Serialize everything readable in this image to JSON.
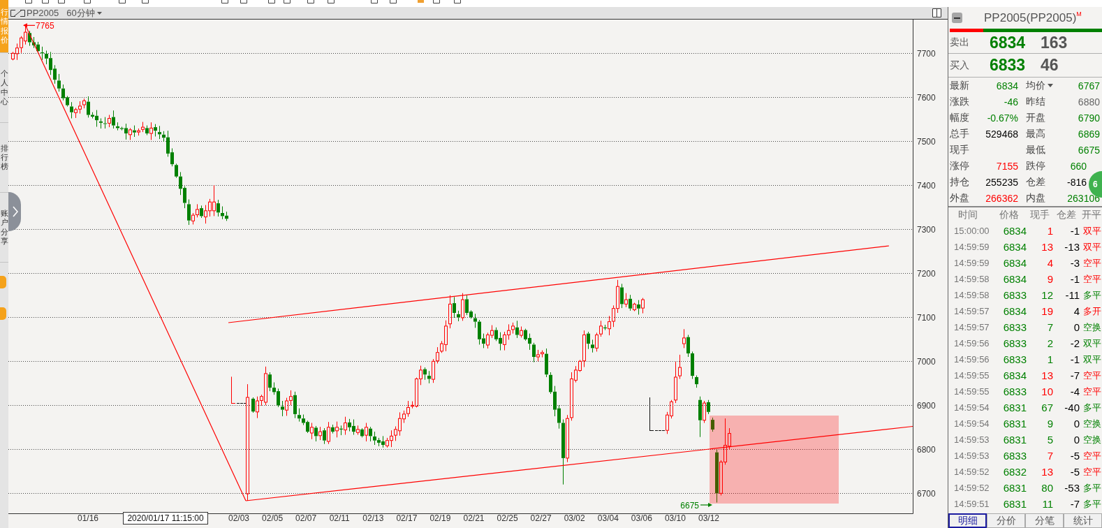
{
  "sidebar": {
    "items": [
      {
        "label": "行情报价",
        "selected": true
      },
      {
        "label": "个人中心",
        "selected": false
      },
      {
        "label": "排行榜",
        "selected": false
      },
      {
        "label": "账户分享",
        "selected": false
      }
    ]
  },
  "chart": {
    "symbol": "PP2005",
    "period": "60分钟",
    "high_marker": "7765",
    "low_marker": "6675",
    "price_axis": [
      "7700",
      "7600",
      "7500",
      "7400",
      "7300",
      "7200",
      "7100",
      "7000",
      "6900",
      "6800",
      "6700"
    ],
    "date_axis": [
      "01/16",
      "02/03",
      "02/05",
      "02/07",
      "02/11",
      "02/13",
      "02/17",
      "02/19",
      "02/21",
      "02/25",
      "02/27",
      "03/02",
      "03/04",
      "03/06",
      "03/10",
      "03/12"
    ],
    "cursor_time": "2020/01/17 11:15:00"
  },
  "quote": {
    "title": "PP2005(PP2005)",
    "title_mark": "M",
    "ratio_bar": {
      "level": 0.22
    },
    "book": [
      {
        "label": "卖出",
        "price": "6834",
        "volume": "163"
      },
      {
        "label": "买入",
        "price": "6833",
        "volume": "46"
      }
    ],
    "stats": [
      {
        "label": "最新",
        "value": "6834",
        "color": "#008000",
        "dropdown": false
      },
      {
        "label": "均价",
        "value": "6767",
        "color": "#008000",
        "dropdown": true
      },
      {
        "label": "涨跌",
        "value": "-46",
        "color": "#008000",
        "dropdown": false
      },
      {
        "label": "昨结",
        "value": "6880",
        "color": "#666666",
        "dropdown": false
      },
      {
        "label": "幅度",
        "value": "-0.67%",
        "color": "#008000",
        "dropdown": false
      },
      {
        "label": "开盘",
        "value": "6790",
        "color": "#008000",
        "dropdown": false
      },
      {
        "label": "总手",
        "value": "529468",
        "color": "#000000",
        "dropdown": false
      },
      {
        "label": "最高",
        "value": "6869",
        "color": "#008000",
        "dropdown": false
      },
      {
        "label": "现手",
        "dropdown": false
      },
      {
        "label": "最低",
        "value": "6675",
        "color": "#008000",
        "dropdown": false
      },
      {
        "label": "涨停",
        "value": "7155",
        "color": "#ff0000",
        "dropdown": false
      },
      {
        "label": "跌停",
        "value": "660",
        "color": "#008000",
        "dropdown": false
      },
      {
        "label": "持仓",
        "value": "255235",
        "color": "#000000",
        "dropdown": false
      },
      {
        "label": "仓差",
        "value": "-816",
        "color": "#000000",
        "dropdown": false
      },
      {
        "label": "外盘",
        "value": "266362",
        "color": "#ff0000",
        "dropdown": false
      },
      {
        "label": "内盘",
        "value": "263106",
        "color": "#008000",
        "dropdown": false
      }
    ],
    "floating_badge": "6"
  },
  "trades": {
    "columns": [
      "时间",
      "价格",
      "现手",
      "仓差",
      "开平"
    ],
    "rows": [
      {
        "time": "15:00:00",
        "price": "6834",
        "volume": "1",
        "change": "-1",
        "type": "双平",
        "color": "#ff0000"
      },
      {
        "time": "14:59:59",
        "price": "6834",
        "volume": "13",
        "change": "-13",
        "type": "双平",
        "color": "#ff0000"
      },
      {
        "time": "14:59:59",
        "price": "6834",
        "volume": "4",
        "change": "-3",
        "type": "空平",
        "color": "#ff0000"
      },
      {
        "time": "14:59:58",
        "price": "6834",
        "volume": "9",
        "change": "-1",
        "type": "空平",
        "color": "#ff0000"
      },
      {
        "time": "14:59:58",
        "price": "6833",
        "volume": "12",
        "change": "-11",
        "type": "多平",
        "color": "#008000"
      },
      {
        "time": "14:59:57",
        "price": "6834",
        "volume": "19",
        "change": "4",
        "type": "多开",
        "color": "#ff0000"
      },
      {
        "time": "14:59:57",
        "price": "6833",
        "volume": "7",
        "change": "0",
        "type": "空换",
        "color": "#008000"
      },
      {
        "time": "14:59:56",
        "price": "6833",
        "volume": "2",
        "change": "-2",
        "type": "双平",
        "color": "#008000"
      },
      {
        "time": "14:59:56",
        "price": "6833",
        "volume": "1",
        "change": "-1",
        "type": "双平",
        "color": "#008000"
      },
      {
        "time": "14:59:55",
        "price": "6834",
        "volume": "13",
        "change": "-7",
        "type": "空平",
        "color": "#ff0000"
      },
      {
        "time": "14:59:55",
        "price": "6833",
        "volume": "10",
        "change": "-4",
        "type": "空平",
        "color": "#ff0000"
      },
      {
        "time": "14:59:54",
        "price": "6831",
        "volume": "67",
        "change": "-40",
        "type": "多平",
        "color": "#008000"
      },
      {
        "time": "14:59:54",
        "price": "6831",
        "volume": "9",
        "change": "0",
        "type": "空换",
        "color": "#008000"
      },
      {
        "time": "14:59:53",
        "price": "6831",
        "volume": "5",
        "change": "0",
        "type": "空换",
        "color": "#008000"
      },
      {
        "time": "14:59:53",
        "price": "6833",
        "volume": "7",
        "change": "-5",
        "type": "空平",
        "color": "#ff0000"
      },
      {
        "time": "14:59:52",
        "price": "6832",
        "volume": "13",
        "change": "-5",
        "type": "空平",
        "color": "#ff0000"
      },
      {
        "time": "14:59:52",
        "price": "6831",
        "volume": "80",
        "change": "-53",
        "type": "多平",
        "color": "#008000"
      },
      {
        "time": "14:59:51",
        "price": "6831",
        "volume": "11",
        "change": "-7",
        "type": "多平",
        "color": "#008000"
      }
    ]
  },
  "tabs": [
    {
      "label": "明细",
      "selected": true
    },
    {
      "label": "分价",
      "selected": false
    },
    {
      "label": "分笔",
      "selected": false
    },
    {
      "label": "统计",
      "selected": false
    }
  ]
}
